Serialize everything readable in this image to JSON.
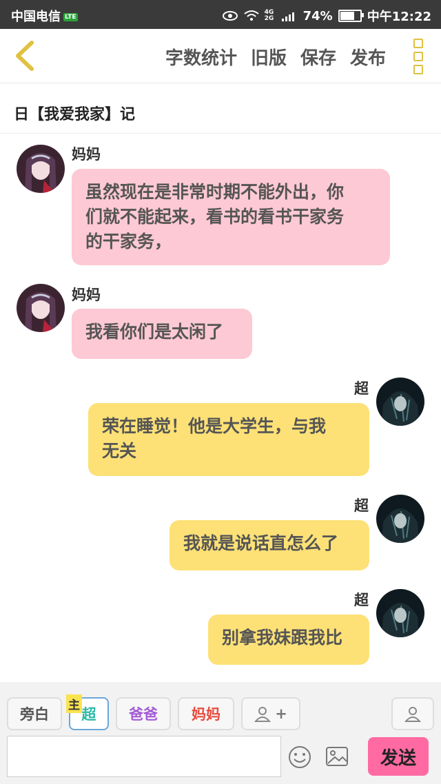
{
  "status_bar": {
    "carrier": "中国电信",
    "lte_badge": "LTE",
    "signal": "4G 2G",
    "battery": "74%",
    "time": "中午12:22"
  },
  "toolbar": {
    "word_count": "字数统计",
    "old_version": "旧版",
    "save": "保存",
    "publish": "发布"
  },
  "story_title": "日【我爱我家】记",
  "messages": [
    {
      "speaker": "妈妈",
      "text_lines": [
        "虽然现在是非常时期不能外出，你",
        "们就不能起来，看书的看书干家务",
        "的干家务，"
      ]
    },
    {
      "speaker": "妈妈",
      "text": "我看你们是太闲了"
    },
    {
      "speaker": "超",
      "text_lines": [
        "荣在睡觉！他是大学生，与我",
        "无关"
      ]
    },
    {
      "speaker": "超",
      "text": "我就是说话直怎么了"
    },
    {
      "speaker": "超",
      "text": "别拿我妹跟我比"
    }
  ],
  "characters": [
    {
      "label": "旁白",
      "color": "#555555"
    },
    {
      "label": "超",
      "color": "#2bb8a6",
      "badge": "主"
    },
    {
      "label": "爸爸",
      "color": "#a35bd6"
    },
    {
      "label": "妈妈",
      "color": "#e84b3c"
    }
  ],
  "add_character_label": "+",
  "send_label": "发送",
  "colors": {
    "mom_bubble": "#fdc9d4",
    "chao_bubble": "#fde176",
    "send_button": "#ff6aa2"
  }
}
